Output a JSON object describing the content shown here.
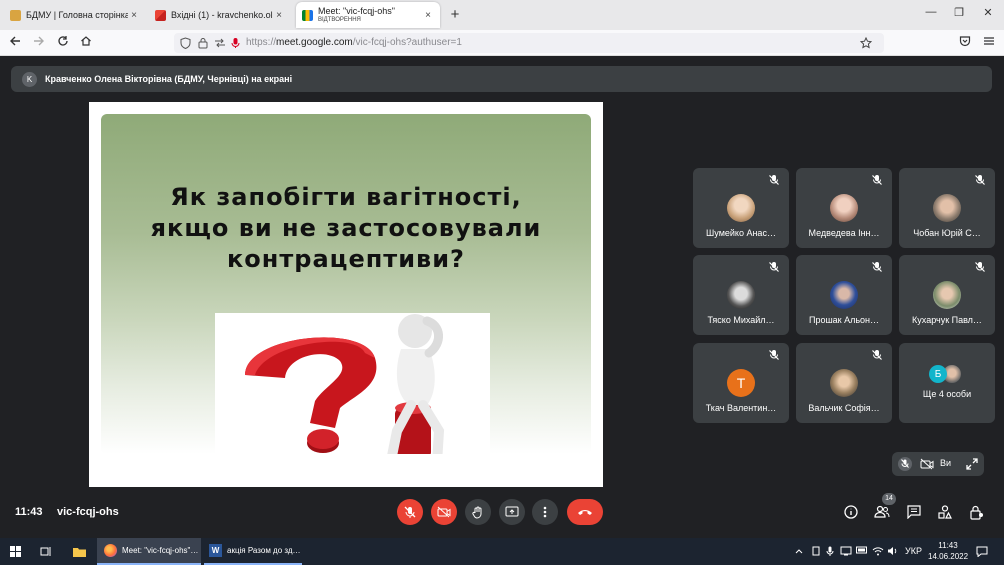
{
  "browser": {
    "tabs": [
      {
        "label": "БДМУ | Головна сторінка",
        "close": "×"
      },
      {
        "label": "Вхідні (1) - kravchenko.olena@",
        "close": "×"
      },
      {
        "label": "Meet: \"vic-fcqj-ohs\"",
        "sublabel": "ВІДТВОРЕННЯ",
        "close": "×"
      }
    ],
    "new_tab": "+",
    "window_controls": {
      "minimize": "—",
      "restore": "❐",
      "close": "✕"
    },
    "url_prefix": "https://",
    "url_host": "meet.google.com",
    "url_path": "/vic-fcqj-ohs?authuser=1"
  },
  "meet": {
    "presenter_initial": "K",
    "presenter_text": "Кравченко Олена Вікторівна (БДМУ, Чернівці) на екрані",
    "slide_title_line1": "Як запобігти вагітності,",
    "slide_title_line2": "якщо ви не застосовували",
    "slide_title_line3": "контрацептиви?",
    "participants": [
      {
        "name": "Шумейко Анас…",
        "photo_color": "#c9a27a"
      },
      {
        "name": "Медведева Інн…",
        "photo_color": "#b58a78"
      },
      {
        "name": "Чобан Юрій С…",
        "photo_color": "#8a7a6c"
      },
      {
        "name": "Тяско Михайл…",
        "photo_color": "#555555"
      },
      {
        "name": "Прошак Альон…",
        "photo_color": "#2f4f9a"
      },
      {
        "name": "Кухарчук Павл…",
        "photo_color": "#7a8c6a"
      },
      {
        "name": "Ткач Валентин…",
        "initial": "Т",
        "initial_color": "#e8711a"
      },
      {
        "name": "Вальчик Софія…",
        "photo_color": "#9a8060"
      }
    ],
    "more": {
      "initial": "Б",
      "initial_color": "#12b5cb",
      "label": "Ще 4 особи"
    },
    "self_view_label": "Ви",
    "time": "11:43",
    "meeting_code": "vic-fcqj-ohs",
    "people_count": "14"
  },
  "taskbar": {
    "firefox_label": "Meet: \"vic-fcqj-ohs\"…",
    "word_label": "акція Разом до зд…",
    "lang": "УКР",
    "clock_time": "11:43",
    "clock_date": "14.06.2022"
  }
}
